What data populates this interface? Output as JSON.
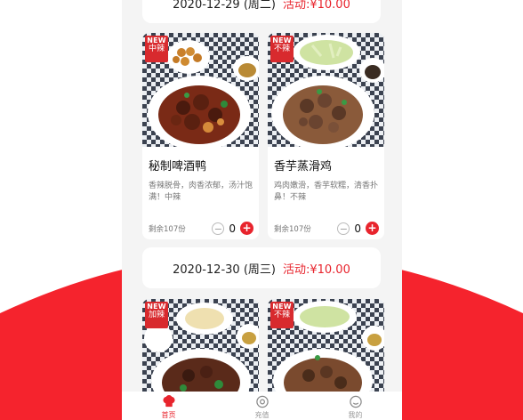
{
  "menu": {
    "days": [
      {
        "date": "2020-12-29 (周二)",
        "promo": "活动:¥10.00"
      },
      {
        "date": "2020-12-30 (周三)",
        "promo": "活动:¥10.00"
      }
    ],
    "dishes_day1": [
      {
        "badge_new": "NEW",
        "badge_tag": "中辣",
        "name": "秘制啤酒鸭",
        "desc": "香辣脱骨，肉香浓郁，汤汁饱满！中辣",
        "stock": "剩余107份",
        "qty": "0"
      },
      {
        "badge_new": "NEW",
        "badge_tag": "不辣",
        "name": "香芋蒸滑鸡",
        "desc": "鸡肉嫩滑，香芋软糯，清香扑鼻！不辣",
        "stock": "剩余107份",
        "qty": "0"
      }
    ],
    "dishes_day2": [
      {
        "badge_new": "NEW",
        "badge_tag": "加辣"
      },
      {
        "badge_new": "NEW",
        "badge_tag": "不辣"
      }
    ]
  },
  "tabbar": {
    "items": [
      {
        "label": "首页",
        "icon": "chef-hat-icon"
      },
      {
        "label": "充值",
        "icon": "recharge-icon"
      },
      {
        "label": "我的",
        "icon": "profile-icon"
      }
    ]
  },
  "colors": {
    "accent": "#e8242d",
    "background_wave": "#f5232d",
    "badge": "#d82a2e"
  }
}
